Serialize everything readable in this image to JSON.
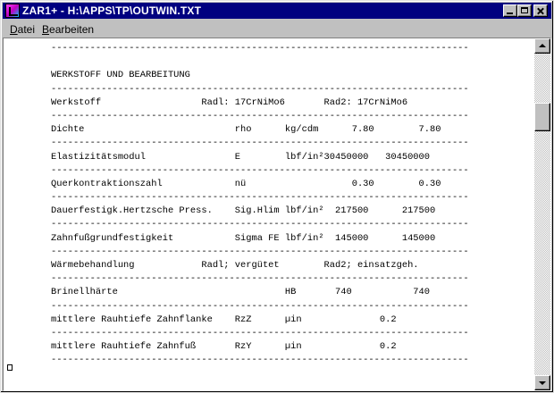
{
  "window": {
    "title": "ZAR1+ - H:\\APPS\\TP\\OUTWIN.TXT"
  },
  "menu": {
    "items": [
      "Datei",
      "Bearbeiten"
    ]
  },
  "report": {
    "lines": [
      "---------------------------------------------------------------------------",
      "",
      "WERKSTOFF UND BEARBEITUNG",
      "---------------------------------------------------------------------------",
      "Werkstoff                  Radl: 17CrNiMo6       Rad2: 17CrNiMo6",
      "---------------------------------------------------------------------------",
      "Dichte                           rho      kg/cdm      7.80        7.80",
      "---------------------------------------------------------------------------",
      "Elastizitätsmodul                E        lbf/in²30450000   30450000",
      "---------------------------------------------------------------------------",
      "Querkontraktionszahl             nü                   0.30        0.30",
      "---------------------------------------------------------------------------",
      "Dauerfestigk.Hertzsche Press.    Sig.Hlim lbf/in²  217500      217500",
      "---------------------------------------------------------------------------",
      "Zahnfußgrundfestigkeit           Sigma FE lbf/in²  145000      145000",
      "---------------------------------------------------------------------------",
      "Wärmebehandlung            Radl; vergütet        Rad2; einsatzgeh.",
      "---------------------------------------------------------------------------",
      "Brinellhärte                              HB       740           740",
      "---------------------------------------------------------------------------",
      "mittlere Rauhtiefe Zahnflanke    RzZ      µin              0.2",
      "---------------------------------------------------------------------------",
      "mittlere Rauhtiefe Zahnfuß       RzY      µin              0.2",
      "---------------------------------------------------------------------------"
    ]
  },
  "colors": {
    "titlebar": "#000080",
    "chrome": "#c0c0c0",
    "text_area": "#ffffff"
  },
  "icons": {
    "app": "zar-app-icon",
    "minimize": "minimize-icon",
    "maximize": "maximize-icon",
    "close": "close-icon"
  }
}
